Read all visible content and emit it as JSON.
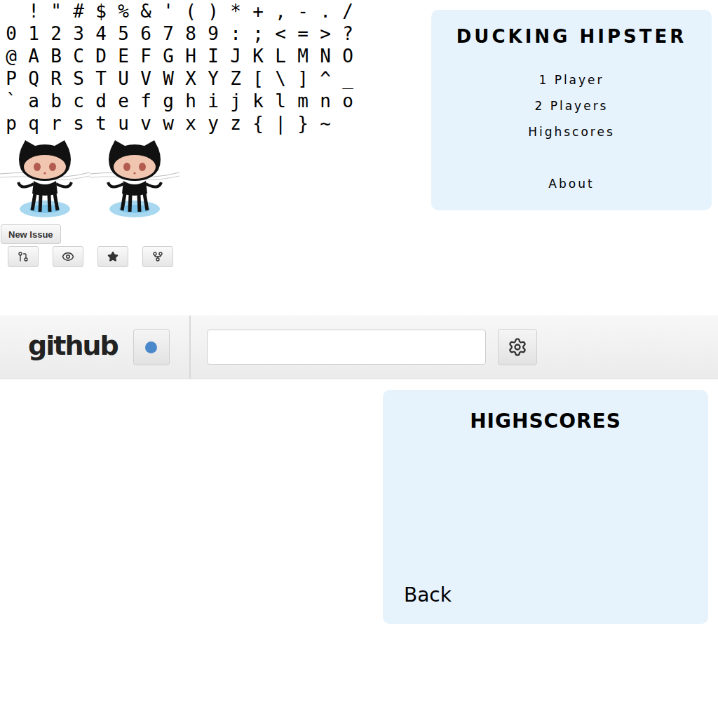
{
  "glyph_atlas": {
    "rows": [
      " !\"#$%&'()*+,-./",
      "0123456789:;<=>?",
      "@ABCDEFGHIJKLMNO",
      "PQRSTUVWXYZ[\\]^_",
      "`abcdefghijklmno",
      "pqrstuvwxyz{|}~"
    ]
  },
  "new_issue_button": {
    "label": "New Issue"
  },
  "menu": {
    "title": "DUCKING HIPSTER",
    "items": [
      "1 Player",
      "2 Players",
      "Highscores",
      "About"
    ]
  },
  "header": {
    "logo": "github",
    "search": {
      "placeholder": "",
      "value": ""
    }
  },
  "highscores": {
    "title": "HIGHSCORES",
    "entries": [],
    "back": "Back"
  }
}
